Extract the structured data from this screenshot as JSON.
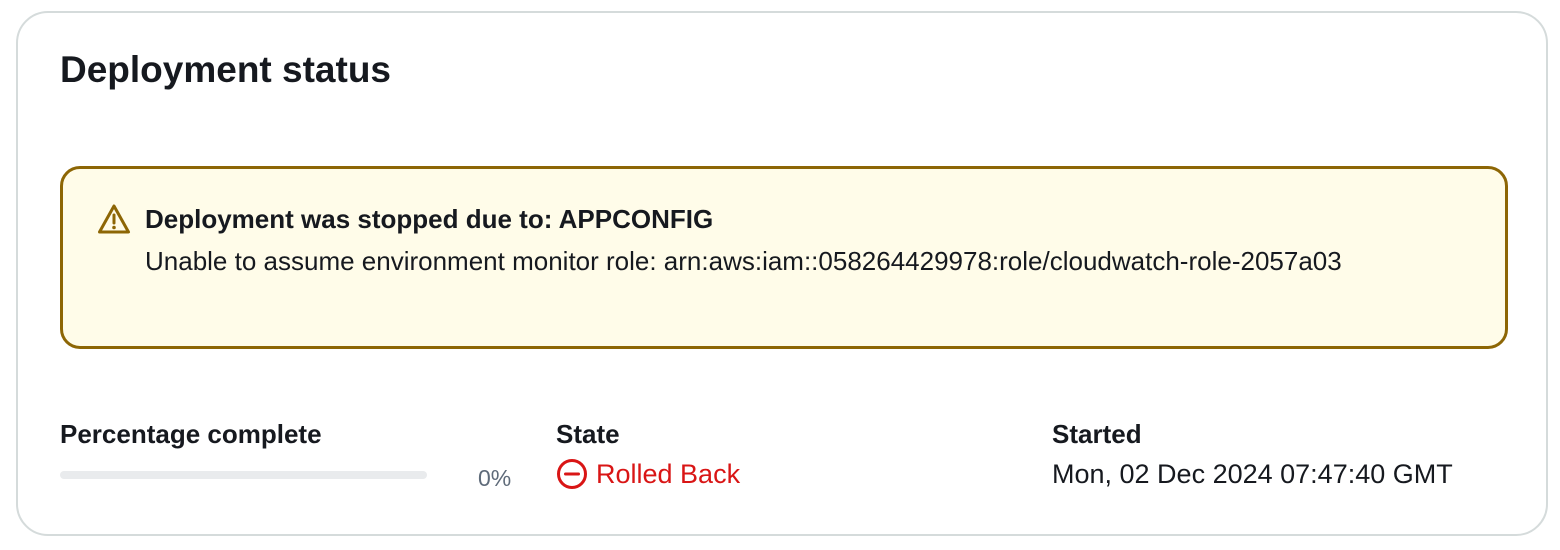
{
  "header": {
    "title": "Deployment status"
  },
  "alert": {
    "icon": "warning-icon",
    "title": "Deployment was stopped due to: APPCONFIG",
    "message": "Unable to assume environment monitor role: arn:aws:iam::058264429978:role/cloudwatch-role-2057a03",
    "border_color": "#8d6605",
    "background_color": "#fffce9"
  },
  "details": {
    "percentage_label": "Percentage complete",
    "percentage_value": 0,
    "percentage_text": "0%",
    "state_label": "State",
    "state_icon": "status-stopped-icon",
    "state_value": "Rolled Back",
    "state_color": "#d91515",
    "started_label": "Started",
    "started_value": "Mon, 02 Dec 2024 07:47:40 GMT"
  }
}
